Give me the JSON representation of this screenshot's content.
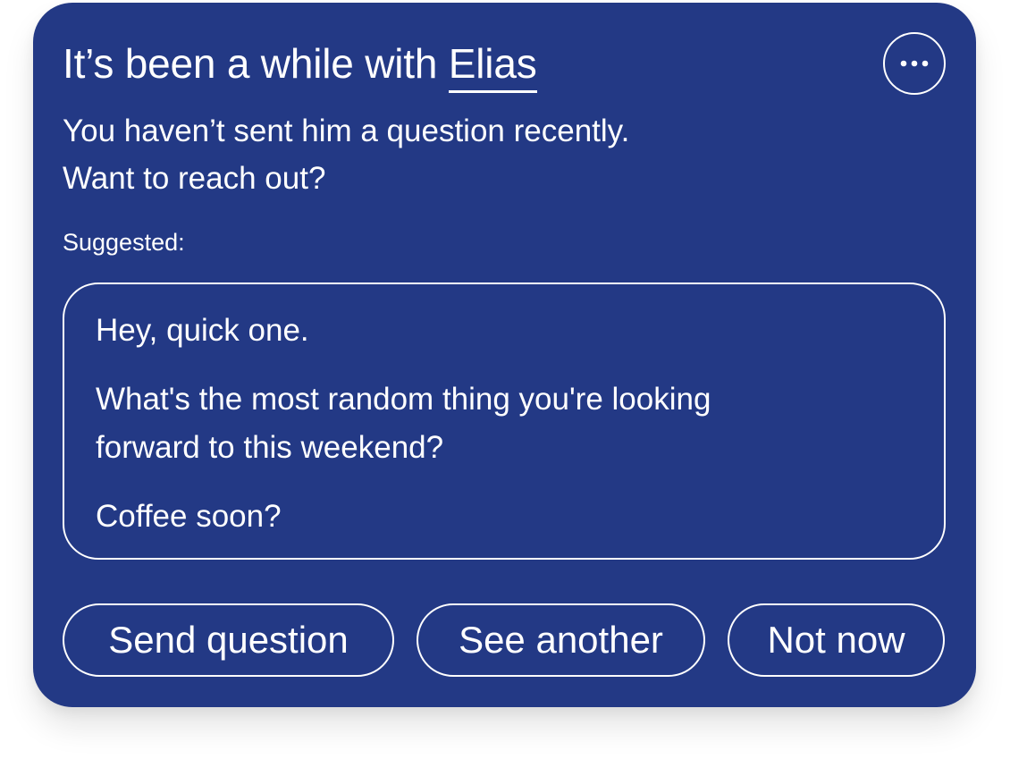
{
  "card": {
    "background_color": "#233985",
    "title_prefix": "It’s been a while with ",
    "contact_name": "Elias",
    "more_icon": "more-horizontal-icon",
    "subtitle_line1": "You haven’t sent him a question recently.",
    "subtitle_line2": "Want to reach out?",
    "suggested_label": "Suggested:",
    "suggestion": {
      "line1": "Hey, quick one.",
      "line2": "What's the most random thing you're looking",
      "line3": "forward to this weekend?",
      "line4": "Coffee soon?"
    },
    "actions": {
      "send": "Send question",
      "another": "See another",
      "not_now": "Not now"
    }
  }
}
